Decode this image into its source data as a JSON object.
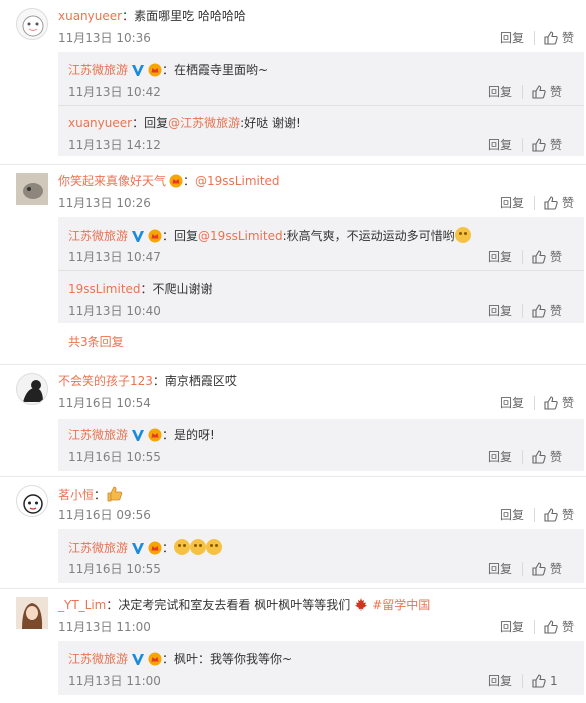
{
  "colors": {
    "accent": "#eb7350",
    "subbg": "#f2f2f5",
    "text": "#333333",
    "muted": "#808080"
  },
  "common": {
    "reply_label": "回复",
    "like_label": "赞",
    "like_icon": "thumbs-up-icon",
    "v_icon": "verified-v-icon",
    "vip_icon": "vip-crown-icon"
  },
  "threads": [
    {
      "user": "xuanyueer",
      "sep": "：",
      "text": "素面哪里吃 哈哈哈哈",
      "time": "11月13日 10:36",
      "replies": [
        {
          "user": "江苏微旅游",
          "sep": "：",
          "text": "在栖霞寺里面哟~",
          "time": "11月13日 10:42"
        },
        {
          "user": "xuanyueer",
          "sep": "：",
          "prefix": "回复",
          "mention": "@江苏微旅游",
          "text": ":好哒 谢谢!",
          "time": "11月13日 14:12"
        }
      ]
    },
    {
      "user": "你笑起来真像好天气",
      "sep": "：",
      "mention": "@19ssLimited",
      "time": "11月13日 10:26",
      "replies": [
        {
          "user": "江苏微旅游",
          "sep": "：",
          "prefix": "回复",
          "mention": "@19ssLimited",
          "text": ":秋高气爽，不运动运动多可惜哟",
          "time": "11月13日 10:47"
        },
        {
          "user": "19ssLimited",
          "sep": "：",
          "text": "不爬山谢谢",
          "time": "11月13日 10:40"
        }
      ],
      "more": "共3条回复"
    },
    {
      "user": "不会笑的孩子123",
      "sep": "：",
      "text": "南京栖霞区哎",
      "time": "11月16日 10:54",
      "replies": [
        {
          "user": "江苏微旅游",
          "sep": "：",
          "text": "是的呀!",
          "time": "11月16日 10:55"
        }
      ]
    },
    {
      "user": "茗小恒",
      "sep": "：",
      "time": "11月16日 09:56",
      "replies": [
        {
          "user": "江苏微旅游",
          "sep": "：",
          "time": "11月16日 10:55"
        }
      ]
    },
    {
      "user": "_YT_Lim",
      "sep": "：",
      "text": "决定考完试和室友去看看 枫叶枫叶等等我们",
      "hashtag": "#留学中国",
      "time": "11月13日 11:00",
      "replies": [
        {
          "user": "江苏微旅游",
          "sep": "：",
          "text": "枫叶：我等你我等你~",
          "time": "11月13日 11:00",
          "likes": "1"
        }
      ]
    }
  ]
}
